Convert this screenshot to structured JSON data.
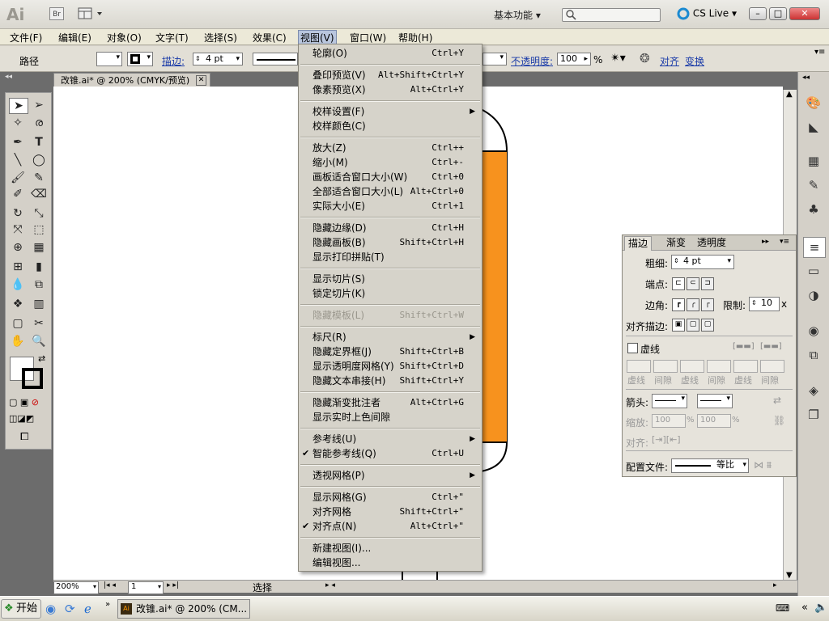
{
  "app": {
    "logo": "Ai",
    "bridge": "Br",
    "workspace": "基本功能",
    "cslive": "CS Live"
  },
  "menubar": [
    {
      "label": "文件(F)"
    },
    {
      "label": "编辑(E)"
    },
    {
      "label": "对象(O)"
    },
    {
      "label": "文字(T)"
    },
    {
      "label": "选择(S)"
    },
    {
      "label": "效果(C)"
    },
    {
      "label": "视图(V)"
    },
    {
      "label": "窗口(W)"
    },
    {
      "label": "帮助(H)"
    }
  ],
  "control": {
    "path_label": "路径",
    "stroke_label": "描边:",
    "stroke_value": "4 pt",
    "opacity_label": "不透明度:",
    "opacity_value": "100",
    "opacity_unit": "%",
    "align_label": "对齐",
    "transform_label": "变换"
  },
  "document": {
    "tab_title": "改锥.ai* @ 200% (CMYK/预览)",
    "zoom": "200%",
    "page": "1",
    "status": "选择"
  },
  "view_menu": {
    "items": [
      {
        "label": "轮廓(O)",
        "shortcut": "Ctrl+Y"
      },
      {
        "sep": true
      },
      {
        "label": "叠印预览(V)",
        "shortcut": "Alt+Shift+Ctrl+Y"
      },
      {
        "label": "像素预览(X)",
        "shortcut": "Alt+Ctrl+Y"
      },
      {
        "sep": true
      },
      {
        "label": "校样设置(F)",
        "shortcut": "",
        "submenu": true
      },
      {
        "label": "校样颜色(C)",
        "shortcut": ""
      },
      {
        "sep": true
      },
      {
        "label": "放大(Z)",
        "shortcut": "Ctrl++"
      },
      {
        "label": "缩小(M)",
        "shortcut": "Ctrl+-"
      },
      {
        "label": "画板适合窗口大小(W)",
        "shortcut": "Ctrl+0"
      },
      {
        "label": "全部适合窗口大小(L)",
        "shortcut": "Alt+Ctrl+0"
      },
      {
        "label": "实际大小(E)",
        "shortcut": "Ctrl+1"
      },
      {
        "sep": true
      },
      {
        "label": "隐藏边缘(D)",
        "shortcut": "Ctrl+H"
      },
      {
        "label": "隐藏画板(B)",
        "shortcut": "Shift+Ctrl+H"
      },
      {
        "label": "显示打印拼贴(T)",
        "shortcut": ""
      },
      {
        "sep": true
      },
      {
        "label": "显示切片(S)",
        "shortcut": ""
      },
      {
        "label": "锁定切片(K)",
        "shortcut": ""
      },
      {
        "sep": true
      },
      {
        "label": "隐藏模板(L)",
        "shortcut": "Shift+Ctrl+W",
        "disabled": true
      },
      {
        "sep": true
      },
      {
        "label": "标尺(R)",
        "shortcut": "",
        "submenu": true
      },
      {
        "label": "隐藏定界框(J)",
        "shortcut": "Shift+Ctrl+B"
      },
      {
        "label": "显示透明度网格(Y)",
        "shortcut": "Shift+Ctrl+D"
      },
      {
        "label": "隐藏文本串接(H)",
        "shortcut": "Shift+Ctrl+Y"
      },
      {
        "sep": true
      },
      {
        "label": "隐藏渐变批注者",
        "shortcut": "Alt+Ctrl+G"
      },
      {
        "label": "显示实时上色间隙",
        "shortcut": ""
      },
      {
        "sep": true
      },
      {
        "label": "参考线(U)",
        "shortcut": "",
        "submenu": true
      },
      {
        "label": "智能参考线(Q)",
        "shortcut": "Ctrl+U",
        "checked": true
      },
      {
        "sep": true
      },
      {
        "label": "透视网格(P)",
        "shortcut": "",
        "submenu": true
      },
      {
        "sep": true
      },
      {
        "label": "显示网格(G)",
        "shortcut": "Ctrl+\""
      },
      {
        "label": "对齐网格",
        "shortcut": "Shift+Ctrl+\""
      },
      {
        "label": "对齐点(N)",
        "shortcut": "Alt+Ctrl+\"",
        "checked": true
      },
      {
        "sep": true
      },
      {
        "label": "新建视图(I)...",
        "shortcut": ""
      },
      {
        "label": "编辑视图...",
        "shortcut": ""
      }
    ]
  },
  "stroke_panel": {
    "tabs": [
      "描边",
      "渐变",
      "透明度"
    ],
    "weight_label": "粗细:",
    "weight_value": "4 pt",
    "cap_label": "端点:",
    "corner_label": "边角:",
    "limit_label": "限制:",
    "limit_value": "10",
    "limit_unit": "x",
    "align_label": "对齐描边:",
    "dashed_label": "虚线",
    "dash_cols": [
      "虚线",
      "间隙",
      "虚线",
      "间隙",
      "虚线",
      "间隙"
    ],
    "arrow_label": "箭头:",
    "scale_label": "缩放:",
    "scale_value1": "100",
    "scale_value2": "100",
    "scale_unit": "%",
    "align2_label": "对齐:",
    "profile_label": "配置文件:",
    "profile_value": "等比"
  },
  "taskbar": {
    "start": "开始",
    "app_title": "改锥.ai* @ 200% (CM..."
  },
  "colors": {
    "orange": "#f7921e",
    "canvas_bg": "#6c6c6c"
  }
}
